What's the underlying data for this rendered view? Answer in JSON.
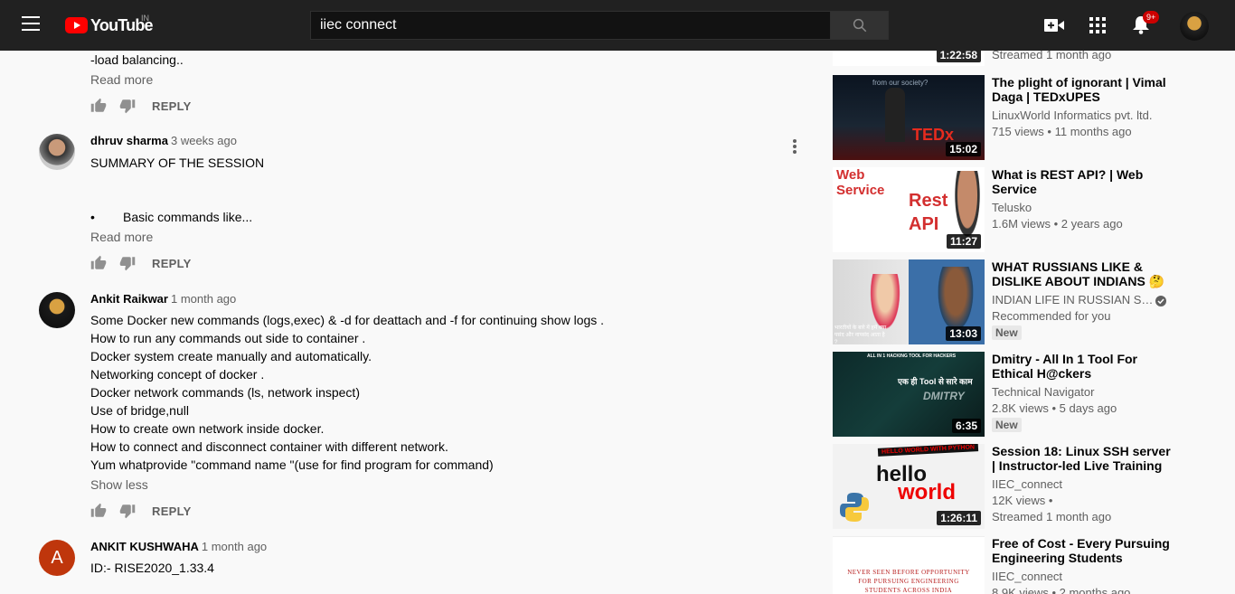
{
  "header": {
    "logo_text": "YouTube",
    "logo_country": "IN",
    "search_value": "iiec connect",
    "notification_count": "9+",
    "icons": [
      "menu-icon",
      "search-icon",
      "create-video-icon",
      "apps-grid-icon",
      "bell-icon"
    ]
  },
  "comments": [
    {
      "partial_line": "-load balancing..",
      "read_more": "Read more",
      "reply": "REPLY"
    },
    {
      "author": "dhruv sharma",
      "time": "3 weeks ago",
      "lines": [
        "SUMMARY OF THE SESSION",
        "",
        "",
        "•        Basic commands like..."
      ],
      "read_more": "Read more",
      "reply": "REPLY"
    },
    {
      "author": "Ankit Raikwar",
      "time": "1 month ago",
      "lines": [
        "Some Docker new commands (logs,exec) & -d  for deattach and -f for continuing show logs .",
        "How to run any commands out side to container .",
        "Docker system create manually and automatically.",
        "Networking concept of docker .",
        "Docker network commands (ls, network inspect)",
        "Use of bridge,null",
        "How to create own network inside docker.",
        "How to connect and disconnect container with different network.",
        "Yum whatprovide \"command name \"(use for find program for command)"
      ],
      "show_less": "Show less",
      "reply": "REPLY"
    },
    {
      "author": "ANKIT KUSHWAHA",
      "time": "1 month ago",
      "avatar_letter": "A",
      "avatar_color": "#bf360c",
      "lines": [
        "ID:- RISE2020_1.33.4"
      ]
    }
  ],
  "sidebar": [
    {
      "duration": "1:22:58",
      "meta": [
        "Streamed 1 month ago"
      ]
    },
    {
      "title": "The plight of ignorant | Vimal Daga | TEDxUPES",
      "channel": "LinuxWorld Informatics pvt. ltd.",
      "stats": "715 views • 11 months ago",
      "duration": "15:02",
      "thumb_text": "from our society?",
      "thumb_logo": "TEDx"
    },
    {
      "title": "What is REST API? | Web Service",
      "channel": "Telusko",
      "stats": "1.6M views • 2 years ago",
      "duration": "11:27",
      "thumb_text_1": "Web Service",
      "thumb_text_2": "Rest API"
    },
    {
      "title": "WHAT RUSSIANS LIKE & DISLIKE ABOUT INDIANS 🤔 R...",
      "channel": "INDIAN LIFE IN RUSSIAN ST...",
      "stats": "Recommended for you",
      "badge": "New",
      "duration": "13:03",
      "thumb_caption": "भारतीयों के बारे में हमें क्या पसंद और नापसंद आता है ?"
    },
    {
      "title": "Dmitry - All In 1 Tool For Ethical H@ckers",
      "channel": "Technical Navigator",
      "stats": "2.8K views • 5 days ago",
      "badge": "New",
      "duration": "6:35",
      "thumb_top": "ALL IN 1 HACKING TOOL FOR HACKERS",
      "thumb_hindi": "एक ही Tool से सारे काम",
      "thumb_name": "DMITRY"
    },
    {
      "title": "Session 18: Linux SSH server | Instructor-led Live Training on...",
      "channel": "IIEC_connect",
      "stats": "12K views •",
      "stats2": "Streamed 1 month ago",
      "duration": "1:26:11",
      "thumb_banner": "HELLO WORLD WITH PYTHON",
      "thumb_word_1": "hello",
      "thumb_word_2": "world"
    },
    {
      "title": "Free of Cost - Every Pursuing Engineering Students Should...",
      "channel": "IIEC_connect",
      "stats": "8.9K views • 2 months ago",
      "thumb_text": "NEVER SEEN BEFORE OPPORTUNITY FOR PURSUING ENGINEERING STUDENTS ACROSS INDIA"
    }
  ]
}
